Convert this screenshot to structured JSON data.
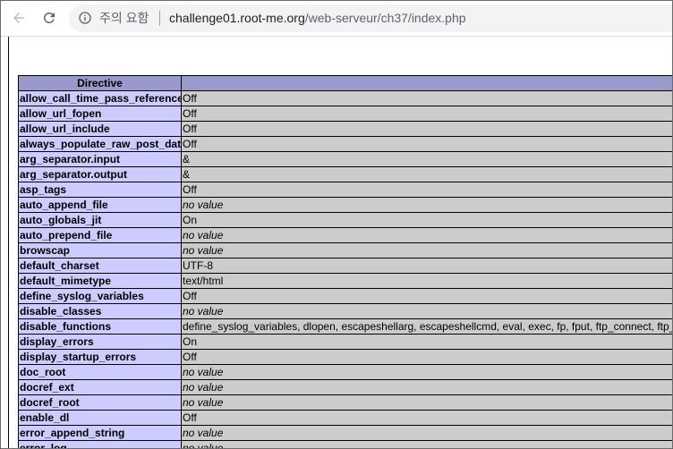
{
  "browser": {
    "security_text": "주의 요함",
    "url_host": "challenge01.root-me.org",
    "url_path": "/web-serveur/ch37/index.php"
  },
  "table": {
    "header": [
      "Directive",
      ""
    ],
    "rows": [
      {
        "directive": "allow_call_time_pass_reference",
        "value": "Off",
        "italic": false
      },
      {
        "directive": "allow_url_fopen",
        "value": "Off",
        "italic": false
      },
      {
        "directive": "allow_url_include",
        "value": "Off",
        "italic": false
      },
      {
        "directive": "always_populate_raw_post_data",
        "value": "Off",
        "italic": false
      },
      {
        "directive": "arg_separator.input",
        "value": "&",
        "italic": false
      },
      {
        "directive": "arg_separator.output",
        "value": "&",
        "italic": false
      },
      {
        "directive": "asp_tags",
        "value": "Off",
        "italic": false
      },
      {
        "directive": "auto_append_file",
        "value": "no value",
        "italic": true
      },
      {
        "directive": "auto_globals_jit",
        "value": "On",
        "italic": false
      },
      {
        "directive": "auto_prepend_file",
        "value": "no value",
        "italic": true
      },
      {
        "directive": "browscap",
        "value": "no value",
        "italic": true
      },
      {
        "directive": "default_charset",
        "value": "UTF-8",
        "italic": false
      },
      {
        "directive": "default_mimetype",
        "value": "text/html",
        "italic": false
      },
      {
        "directive": "define_syslog_variables",
        "value": "Off",
        "italic": false
      },
      {
        "directive": "disable_classes",
        "value": "no value",
        "italic": true
      },
      {
        "directive": "disable_functions",
        "value": "define_syslog_variables, dlopen, escapeshellarg, escapeshellcmd, eval, exec, fp, fput, ftp_connect, ftp_",
        "italic": false
      },
      {
        "directive": "display_errors",
        "value": "On",
        "italic": false
      },
      {
        "directive": "display_startup_errors",
        "value": "Off",
        "italic": false
      },
      {
        "directive": "doc_root",
        "value": "no value",
        "italic": true
      },
      {
        "directive": "docref_ext",
        "value": "no value",
        "italic": true
      },
      {
        "directive": "docref_root",
        "value": "no value",
        "italic": true
      },
      {
        "directive": "enable_dl",
        "value": "Off",
        "italic": false
      },
      {
        "directive": "error_append_string",
        "value": "no value",
        "italic": true
      },
      {
        "directive": "error_log",
        "value": "no value",
        "italic": true
      }
    ]
  }
}
